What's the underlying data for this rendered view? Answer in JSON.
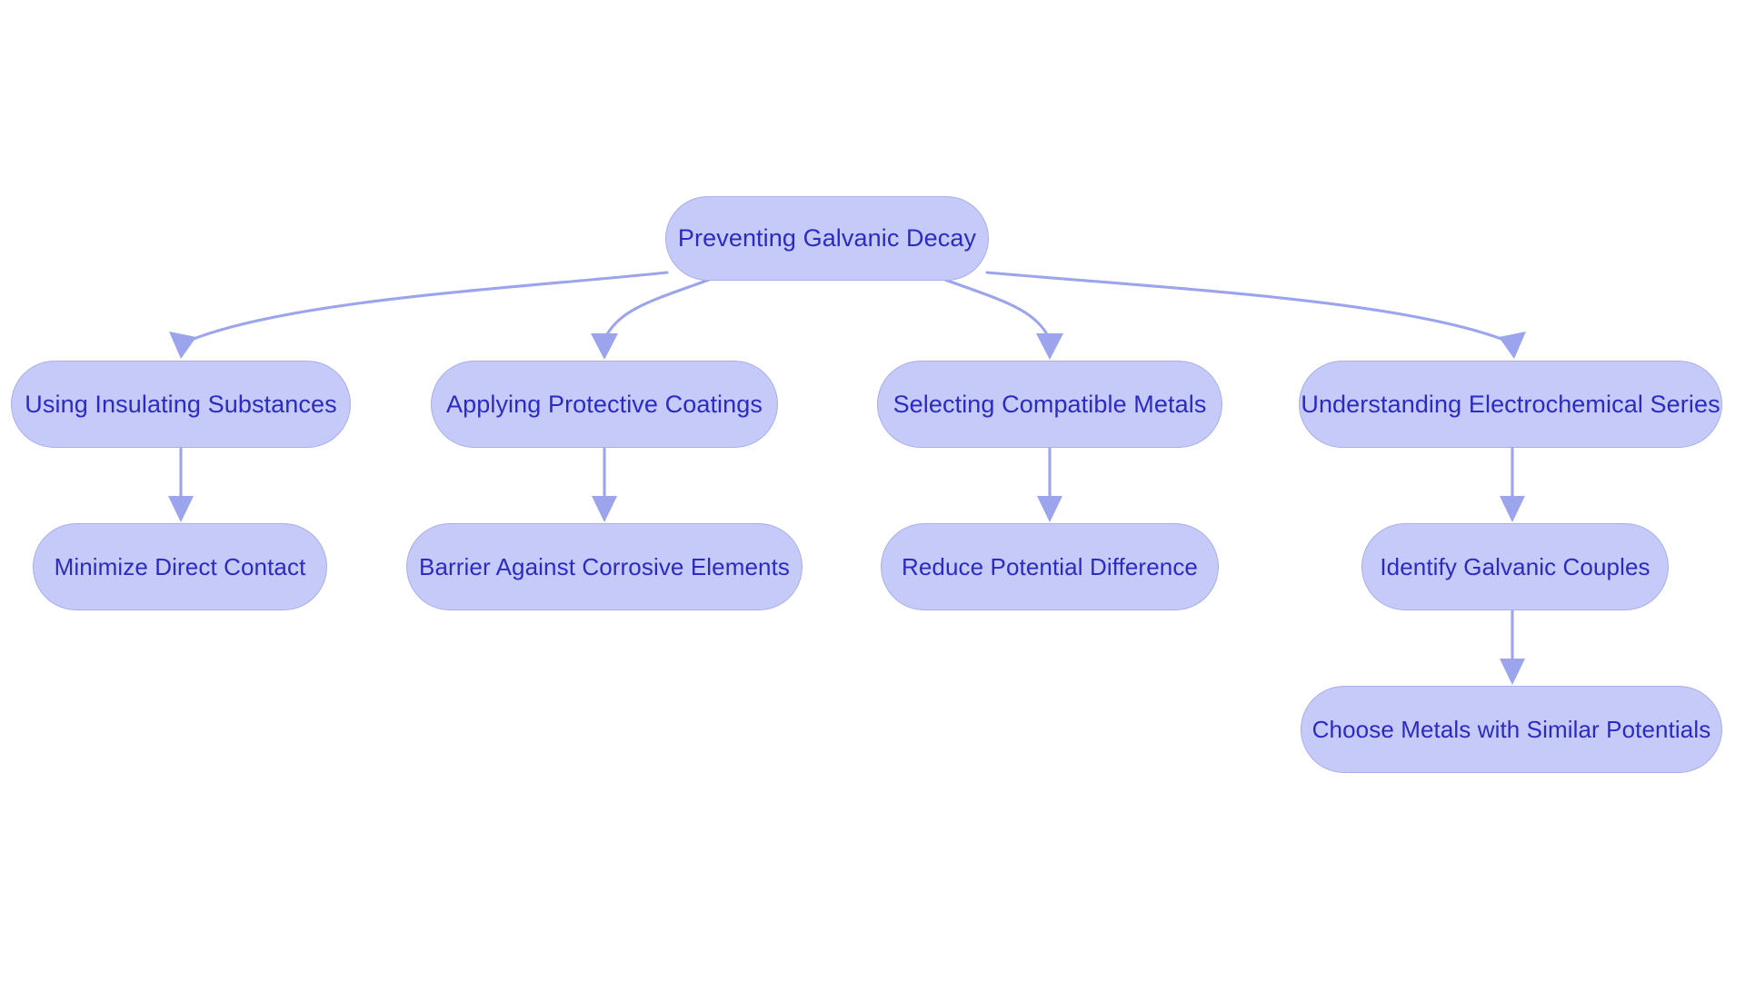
{
  "diagram": {
    "title": "Preventing Galvanic Decay",
    "type": "flowchart",
    "orientation": "top-down",
    "background_color": "#ffffff",
    "node_fill_color": "#c6caf9",
    "node_border_color": "#a9aeea",
    "node_text_color": "#2b2bc4",
    "edge_color": "#9ba4ec",
    "nodes": {
      "root": {
        "label": "Preventing Galvanic Decay"
      },
      "branch_1": {
        "label": "Using Insulating Substances"
      },
      "branch_2": {
        "label": "Applying Protective Coatings"
      },
      "branch_3": {
        "label": "Selecting Compatible Metals"
      },
      "branch_4": {
        "label": "Understanding Electrochemical Series"
      },
      "leaf_1": {
        "label": "Minimize Direct Contact"
      },
      "leaf_2": {
        "label": "Barrier Against Corrosive Elements"
      },
      "leaf_3": {
        "label": "Reduce Potential Difference"
      },
      "leaf_4": {
        "label": "Identify Galvanic Couples"
      },
      "leaf_5": {
        "label": "Choose Metals with Similar Potentials"
      }
    },
    "edges": [
      {
        "from": "root",
        "to": "branch_1"
      },
      {
        "from": "root",
        "to": "branch_2"
      },
      {
        "from": "root",
        "to": "branch_3"
      },
      {
        "from": "root",
        "to": "branch_4"
      },
      {
        "from": "branch_1",
        "to": "leaf_1"
      },
      {
        "from": "branch_2",
        "to": "leaf_2"
      },
      {
        "from": "branch_3",
        "to": "leaf_3"
      },
      {
        "from": "branch_4",
        "to": "leaf_4"
      },
      {
        "from": "leaf_4",
        "to": "leaf_5"
      }
    ]
  }
}
